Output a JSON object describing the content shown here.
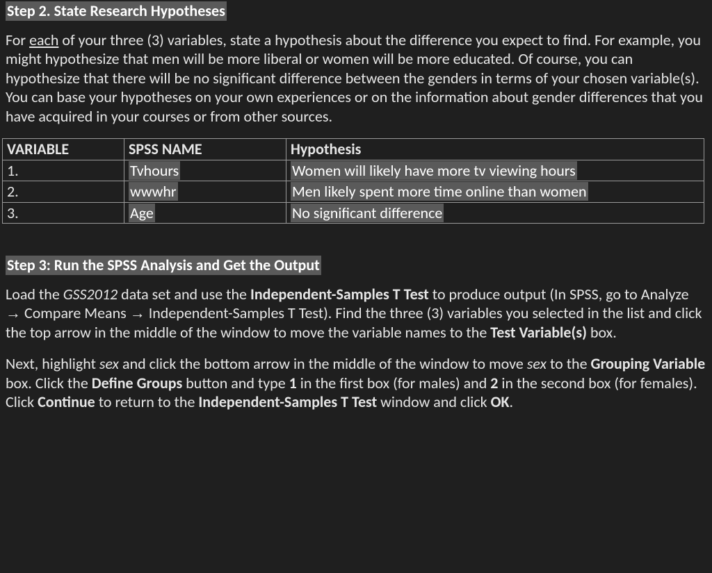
{
  "step2": {
    "heading": "Step 2. State Research Hypotheses",
    "para_pre": "For ",
    "para_each": "each",
    "para_post": " of your three (3) variables, state a hypothesis about the difference you expect to find. For example, you might hypothesize that men will be more liberal or women will be more educated.  Of course, you can hypothesize that there will be no significant difference between the genders in terms of your chosen variable(s).  You can base your hypotheses on your own experiences or on the information about gender differences that you have acquired in your courses or from other sources."
  },
  "table": {
    "headers": {
      "variable": "VARIABLE",
      "spss": "SPSS NAME",
      "hypothesis": "Hypothesis"
    },
    "rows": [
      {
        "n": "1.",
        "spss": "Tvhours",
        "hyp": "Women will likely have more tv viewing hours"
      },
      {
        "n": "2.",
        "spss": "wwwhr",
        "hyp": "Men likely spent more time online than women"
      },
      {
        "n": "3.",
        "spss": "Age",
        "hyp": "No significant difference"
      }
    ]
  },
  "step3": {
    "heading": "Step 3: Run the SPSS Analysis and Get the Output",
    "p1": {
      "t1": "Load the ",
      "gss": "GSS2012",
      "t2": " data set and use the ",
      "istt": "Independent-Samples T Test",
      "t3": " to produce output (In SPSS, go to Analyze ",
      "arrow": "→",
      "t4": " Compare Means ",
      "t5": " Independent-Samples T Test).  Find the three (3) variables you selected in the list and click the top arrow in the middle of the window to move the variable names to the ",
      "tv": "Test Variable(s)",
      "t6": " box."
    },
    "p2": {
      "t1": "Next, highlight ",
      "sex": "sex",
      "t2": " and click the bottom arrow in the middle of the window to move ",
      "t3": " to the ",
      "gv": "Grouping Variable",
      "t4": " box. Click the ",
      "dg": "Define Groups",
      "t5": " button and type ",
      "one": "1",
      "t6": " in the first box (for males) and ",
      "two": "2",
      "t7": " in the second box (for females). Click ",
      "cont": "Continue",
      "t8": " to return to the ",
      "istt": "Independent-Samples T Test",
      "t9": " window and click ",
      "ok": "OK",
      "t10": "."
    }
  }
}
